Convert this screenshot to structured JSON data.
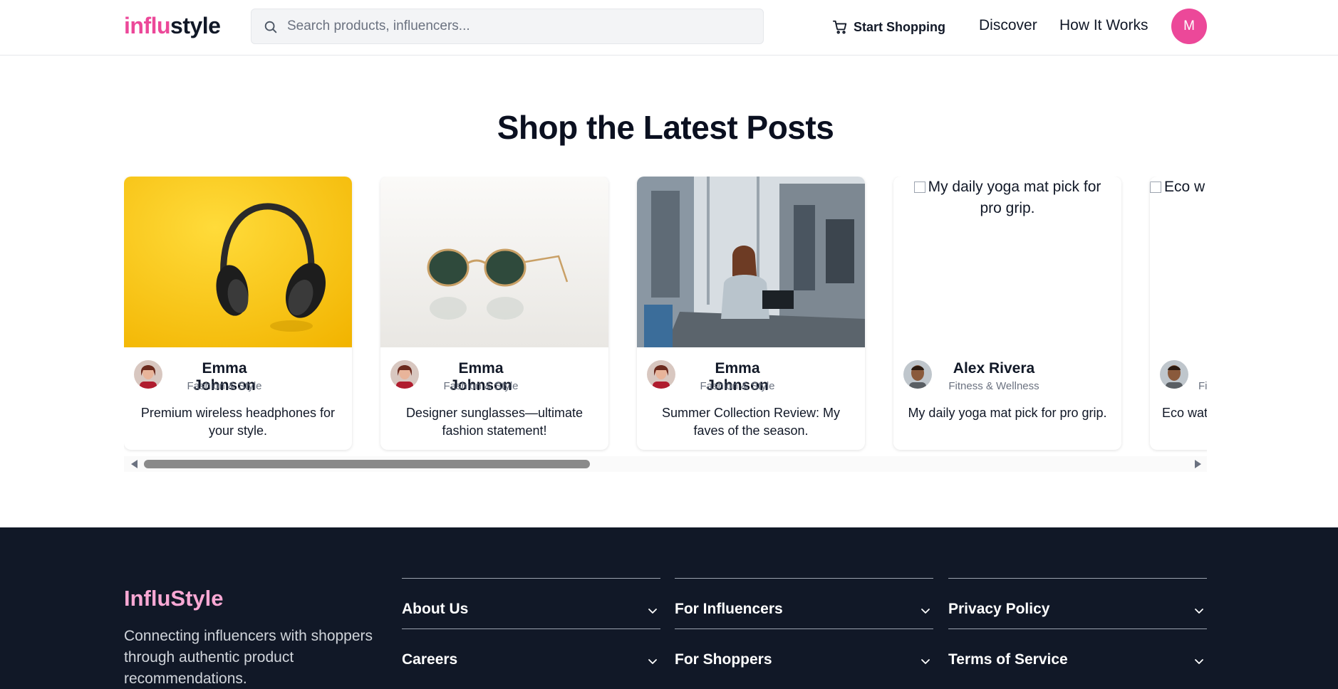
{
  "header": {
    "logo_part1": "influ",
    "logo_part2": "style",
    "search_placeholder": "Search products, influencers...",
    "start_shopping": "Start Shopping",
    "nav": [
      "Discover",
      "How It Works"
    ],
    "avatar_initial": "M"
  },
  "section": {
    "title": "Shop the Latest Posts"
  },
  "posts": [
    {
      "name": "Emma Johnson",
      "category": "Fashion & Style",
      "caption": "Premium wireless headphones for your style."
    },
    {
      "name": "Emma Johnson",
      "category": "Fashion & Style",
      "caption": "Designer sunglasses—ultimate fashion statement!"
    },
    {
      "name": "Emma Johnson",
      "category": "Fashion & Style",
      "caption": "Summer Collection Review: My faves of the season."
    },
    {
      "name": "Alex Rivera",
      "category": "Fitness & Wellness",
      "caption": "My daily yoga mat pick for pro grip.",
      "image_alt": "My daily yoga mat pick for pro grip."
    },
    {
      "category": "Fi",
      "caption": "Eco wat",
      "image_alt": "Eco w"
    }
  ],
  "footer": {
    "brand": "InfluStyle",
    "description": "Connecting influencers with shoppers through authentic product recommendations.",
    "links": [
      "About Us",
      "For Influencers",
      "Privacy Policy",
      "Careers",
      "For Shoppers",
      "Terms of Service"
    ]
  },
  "colors": {
    "brand_pink": "#ec4899",
    "footer_bg": "#111827",
    "footer_brand": "#f9a8d4"
  }
}
